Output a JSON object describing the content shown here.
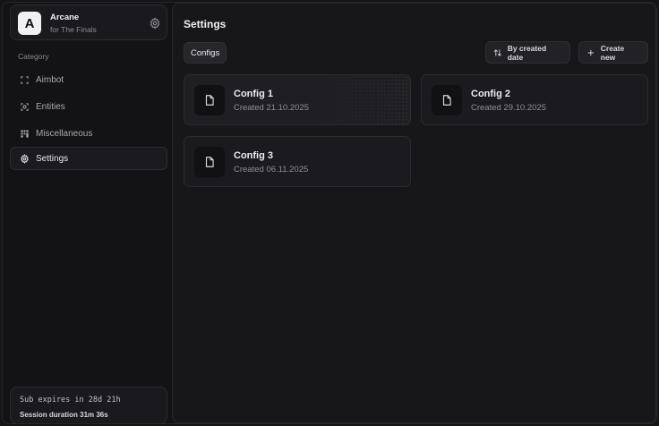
{
  "brand": {
    "logo_letter": "A",
    "name": "Arcane",
    "subtitle": "for The Finals"
  },
  "sidebar": {
    "category_label": "Category",
    "items": [
      {
        "label": "Aimbot",
        "icon": "crosshair-frame-icon",
        "active": false
      },
      {
        "label": "Entities",
        "icon": "target-icon",
        "active": false
      },
      {
        "label": "Miscellaneous",
        "icon": "grid-icon",
        "active": false
      },
      {
        "label": "Settings",
        "icon": "gear-icon",
        "active": true
      }
    ]
  },
  "footer": {
    "subscription": "Sub expires in 28d 21h",
    "session": "Session duration 31m 36s"
  },
  "main": {
    "title": "Settings",
    "tab_label": "Configs",
    "sort_label": "By created date",
    "create_label": "Create new"
  },
  "configs": [
    {
      "name": "Config 1",
      "created": "Created 21.10.2025"
    },
    {
      "name": "Config 2",
      "created": "Created 29.10.2025"
    },
    {
      "name": "Config 3",
      "created": "Created 06.11.2025"
    }
  ],
  "colors": {
    "background": "#131316",
    "panel": "#17171a",
    "card": "#1b1b1f",
    "accent_text": "#ededf0",
    "muted_text": "#8a8a92"
  }
}
